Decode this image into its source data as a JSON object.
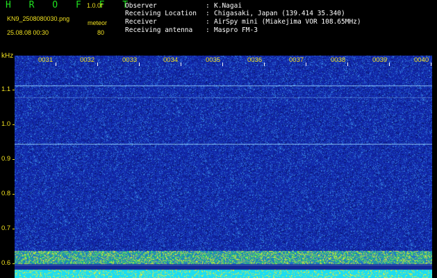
{
  "header": {
    "app_title": "H R O F F T",
    "version": "1.0.0f",
    "filename": "KN9_2508080030.png",
    "mode": "meteor",
    "datetime": "25.08.08 00:30",
    "gain": "80"
  },
  "info": [
    {
      "key": "Observer",
      "colon": ":",
      "value": "K.Nagai"
    },
    {
      "key": "Receiving Location",
      "colon": ":",
      "value": "Chigasaki, Japan (139.414 35.340)"
    },
    {
      "key": "Receiver",
      "colon": ":",
      "value": "AirSpy mini (Miakejima VOR 108.65MHz)"
    },
    {
      "key": "Receiving antenna",
      "colon": ":",
      "value": "Maspro FM-3"
    }
  ],
  "axis": {
    "y_unit": "kHz",
    "y_ticks": [
      "1.1",
      "1.0",
      "0.9",
      "0.8",
      "0.7",
      "0.6"
    ],
    "x_ticks": [
      "0031",
      "0032",
      "0033",
      "0034",
      "0035",
      "0036",
      "0037",
      "0038",
      "0039",
      "0040"
    ]
  },
  "colors": {
    "background": "#000000",
    "noise_floor": "#1a2fb0",
    "label_yellow": "#f0e020",
    "title_green": "#20e020",
    "carrier_line": "#9fdcff"
  }
}
